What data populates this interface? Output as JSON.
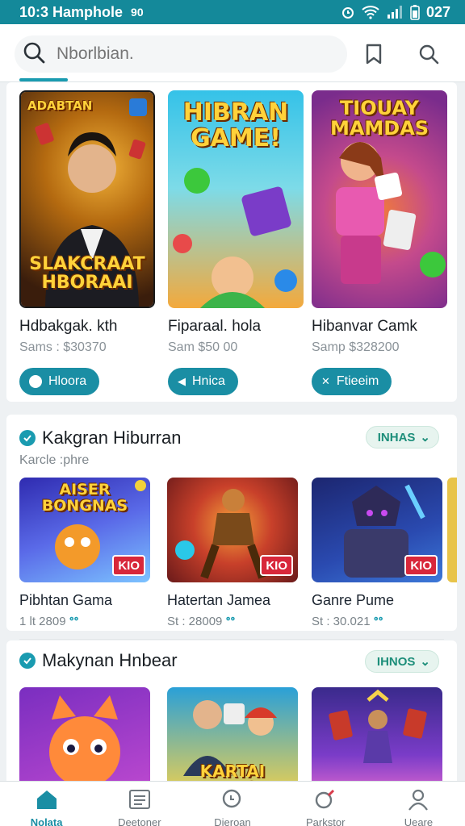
{
  "status": {
    "left_text": "10:3 Hamphole",
    "left_extra": "90",
    "time": "027"
  },
  "search": {
    "placeholder": "Nborlbian.",
    "value": ""
  },
  "featured": [
    {
      "title": "ADABTAN",
      "title_bottom": "SLAKCRAAT HBORAAI",
      "name": "Hdbakgak. kth",
      "meta": "Sams : $30370",
      "button": "Hloora",
      "colors": [
        "#3a1d0c",
        "#b46a10"
      ]
    },
    {
      "title": "HIBRAN GAME!",
      "name": "Fiparaal. hola",
      "meta": "Sam  $50 00",
      "button": "Hnica",
      "colors": [
        "#35c2e8",
        "#f3a93c"
      ]
    },
    {
      "title": "TIOUAY MAMDAS",
      "name": "Hibanvar Camk",
      "meta": "Samp  $328200",
      "button": "Ftieeim",
      "colors": [
        "#7a2c8c",
        "#f07a3c"
      ]
    }
  ],
  "sections": [
    {
      "title": "Kakgran Hiburran",
      "subtitle": "Karcle :phre",
      "more": "INHAS",
      "games": [
        {
          "title": "AISER BONGNAS",
          "badge": "KIO",
          "name": "Pibhtan Gama",
          "meta": "1 lt  2809",
          "colors": [
            "#2f2bb0",
            "#7cc3ff"
          ]
        },
        {
          "title": "",
          "badge": "KIO",
          "name": "Hatertan Jamea",
          "meta": "St : 28009",
          "colors": [
            "#6a1a1a",
            "#f4a23a"
          ]
        },
        {
          "title": "",
          "badge": "KIO",
          "name": "Ganre Pume",
          "meta": "St : 30.021",
          "colors": [
            "#1c2670",
            "#3c78d8"
          ]
        }
      ]
    },
    {
      "title": "Makynan Hnbear",
      "subtitle": "",
      "more": "IHNOS",
      "games": [
        {
          "title": "",
          "badge": "",
          "name": "",
          "meta": "",
          "colors": [
            "#7a2ec0",
            "#ff8a3a"
          ]
        },
        {
          "title": "KARTAI KUNAST",
          "badge": "",
          "name": "",
          "meta": "",
          "colors": [
            "#2aa0d8",
            "#f5d24a"
          ]
        },
        {
          "title": "",
          "badge": "",
          "name": "",
          "meta": "",
          "colors": [
            "#3a2a8c",
            "#e86bd0"
          ]
        }
      ]
    }
  ],
  "nav": [
    {
      "label": "Nolata",
      "icon": "home-icon",
      "active": true
    },
    {
      "label": "Deetoner",
      "icon": "list-icon",
      "active": false
    },
    {
      "label": "Dieroan",
      "icon": "search-icon",
      "active": false
    },
    {
      "label": "Parkstor",
      "icon": "tag-icon",
      "active": false
    },
    {
      "label": "Ueare",
      "icon": "user-icon",
      "active": false
    }
  ],
  "colors": {
    "accent": "#1a8ea4",
    "status_bar": "#14899a"
  }
}
